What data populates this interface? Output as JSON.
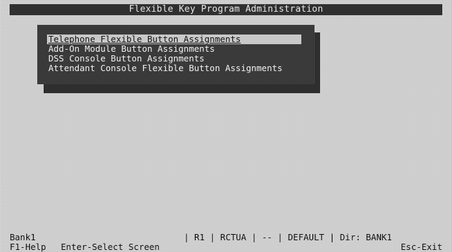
{
  "window": {
    "title": "Flexible Key Program Administration"
  },
  "menu": {
    "items": [
      {
        "label": "Telephone Flexible Button Assignments",
        "selected": true
      },
      {
        "label": "Add-On Module Button Assignments",
        "selected": false
      },
      {
        "label": "DSS Console Button Assignments",
        "selected": false
      },
      {
        "label": "Attendant Console Flexible Button Assignments",
        "selected": false
      }
    ]
  },
  "status": {
    "bank": "Bank1",
    "segment": "| R1 | RCTUA | -- | DEFAULT  | Dir: BANK1"
  },
  "hints": {
    "help": "F1-Help",
    "select": "Enter-Select Screen",
    "exit": "Esc-Exit"
  },
  "colors": {
    "desktop": "#c6c6c6",
    "title_bar": "#303030",
    "menu_box": "#3a3a3a",
    "selection": "#c9c9c9"
  }
}
